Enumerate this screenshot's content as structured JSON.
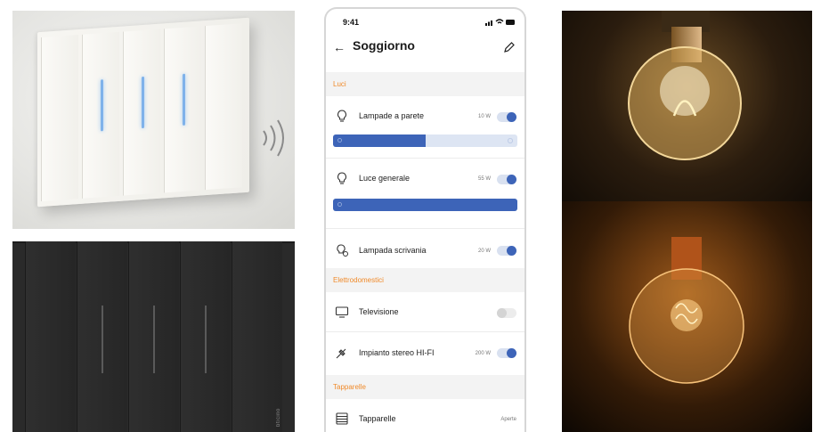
{
  "phone": {
    "status_time": "9:41",
    "title": "Soggiorno",
    "sections": {
      "lights_label": "Luci",
      "appliances_label": "Elettrodomestici",
      "shutters_label": "Tapparelle"
    },
    "rows": [
      {
        "label": "Lampade a parete",
        "power": "10 W",
        "toggle": "on",
        "icon": "bulb-icon",
        "dimmer_level": 0.5
      },
      {
        "label": "Luce generale",
        "power": "55 W",
        "toggle": "on",
        "icon": "bulb-icon",
        "dimmer_level": 1.0
      },
      {
        "label": "Lampada scrivania",
        "power": "20 W",
        "toggle": "on",
        "icon": "bulb-plug-icon"
      },
      {
        "label": "Televisione",
        "power": "",
        "toggle": "off",
        "icon": "tv-icon"
      },
      {
        "label": "Impianto stereo HI-FI",
        "power": "200 W",
        "toggle": "on",
        "icon": "plug-icon"
      },
      {
        "label": "Tapparelle",
        "status": "Aperte",
        "icon": "shutter-icon"
      }
    ]
  },
  "photos": {
    "dark_switch_brand": "bticino"
  },
  "colors": {
    "accent_blue": "#3d64b8",
    "section_orange": "#f08a2a",
    "led_blue": "#7fb2ea"
  }
}
